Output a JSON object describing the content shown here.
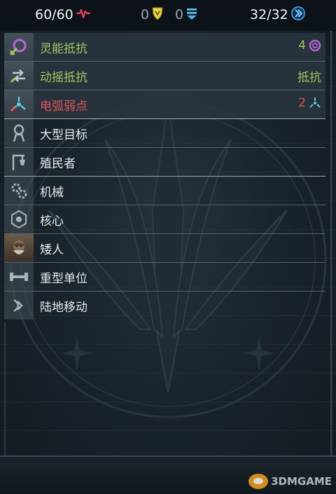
{
  "stats": {
    "health": "60/60",
    "armor": "0",
    "shield": "0",
    "energy": "32/32",
    "colors": {
      "health_icon": "#e8405a",
      "armor_icon": "#e6d243",
      "shield_icon": "#4fb8e0",
      "energy_icon": "#3a8fd8"
    }
  },
  "resistances": [
    {
      "label": "灵能抵抗",
      "value": "4",
      "icon": "psionic-icon",
      "color": "#9fc760"
    },
    {
      "label": "动摇抵抗",
      "value": "抵抗",
      "icon": "stagger-icon",
      "color": "#9fc760"
    },
    {
      "label": "电弧弱点",
      "value": "2",
      "icon": "arc-icon",
      "color": "#e0555a"
    }
  ],
  "traits": [
    {
      "label": "大型目标",
      "icon": "large-target-icon"
    },
    {
      "label": "殖民者",
      "icon": "colonist-icon"
    },
    {
      "label": "机械",
      "icon": "mechanical-icon"
    },
    {
      "label": "核心",
      "icon": "core-icon"
    },
    {
      "label": "矮人",
      "icon": "dwarf-icon"
    },
    {
      "label": "重型单位",
      "icon": "heavy-unit-icon"
    },
    {
      "label": "陆地移动",
      "icon": "ground-movement-icon"
    }
  ],
  "watermark": "3DMGAME"
}
